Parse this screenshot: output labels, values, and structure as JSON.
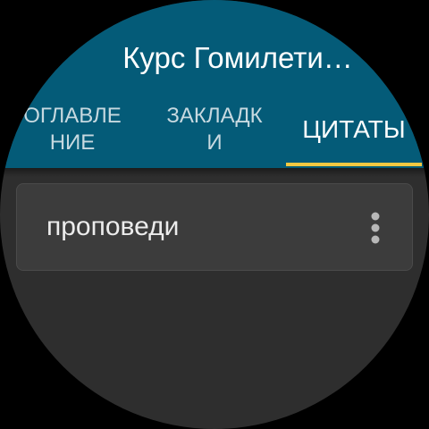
{
  "app_bar": {
    "title": "Курс Гомилети…"
  },
  "tabs": [
    {
      "label": "Оглавление",
      "active": false
    },
    {
      "label": "Закладки",
      "active": false
    },
    {
      "label": "Цитаты",
      "active": true
    }
  ],
  "list": {
    "items": [
      {
        "text": "проповеди",
        "menu_icon": "more-vert-icon"
      }
    ]
  },
  "colors": {
    "app_bar": "#045b78",
    "background": "#2e2e2e",
    "tab_indicator": "#f4c842",
    "card": "#3c3c3c",
    "menu_dots": "#b8b8b8"
  }
}
